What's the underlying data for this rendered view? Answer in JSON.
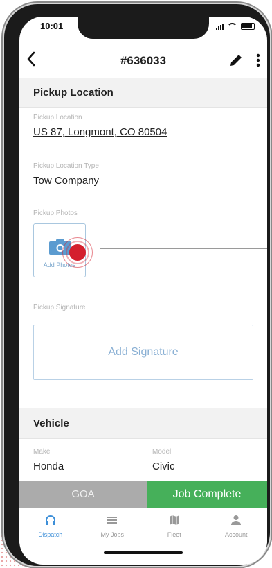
{
  "status": {
    "time": "10:01"
  },
  "header": {
    "title": "#636033"
  },
  "pickup": {
    "section_title": "Pickup Location",
    "location_label": "Pickup Location",
    "location_value": "US 87, Longmont, CO 80504",
    "type_label": "Pickup Location Type",
    "type_value": "Tow Company",
    "photos_label": "Pickup Photos",
    "add_photos_label": "Add Photos",
    "signature_label": "Pickup Signature",
    "add_signature_label": "Add Signature"
  },
  "vehicle": {
    "section_title": "Vehicle",
    "make_label": "Make",
    "make_value": "Honda",
    "model_label": "Model",
    "model_value": "Civic"
  },
  "actions": {
    "goa_label": "GOA",
    "complete_label": "Job Complete"
  },
  "tabs": [
    {
      "label": "Dispatch",
      "icon": "headset-icon",
      "active": true
    },
    {
      "label": "My Jobs",
      "icon": "list-icon",
      "active": false
    },
    {
      "label": "Fleet",
      "icon": "map-icon",
      "active": false
    },
    {
      "label": "Account",
      "icon": "person-icon",
      "active": false
    }
  ],
  "colors": {
    "accent": "#3d8fd8",
    "complete_green": "#46b05a",
    "goa_gray": "#ababab",
    "marker_red": "#d41f2d"
  }
}
